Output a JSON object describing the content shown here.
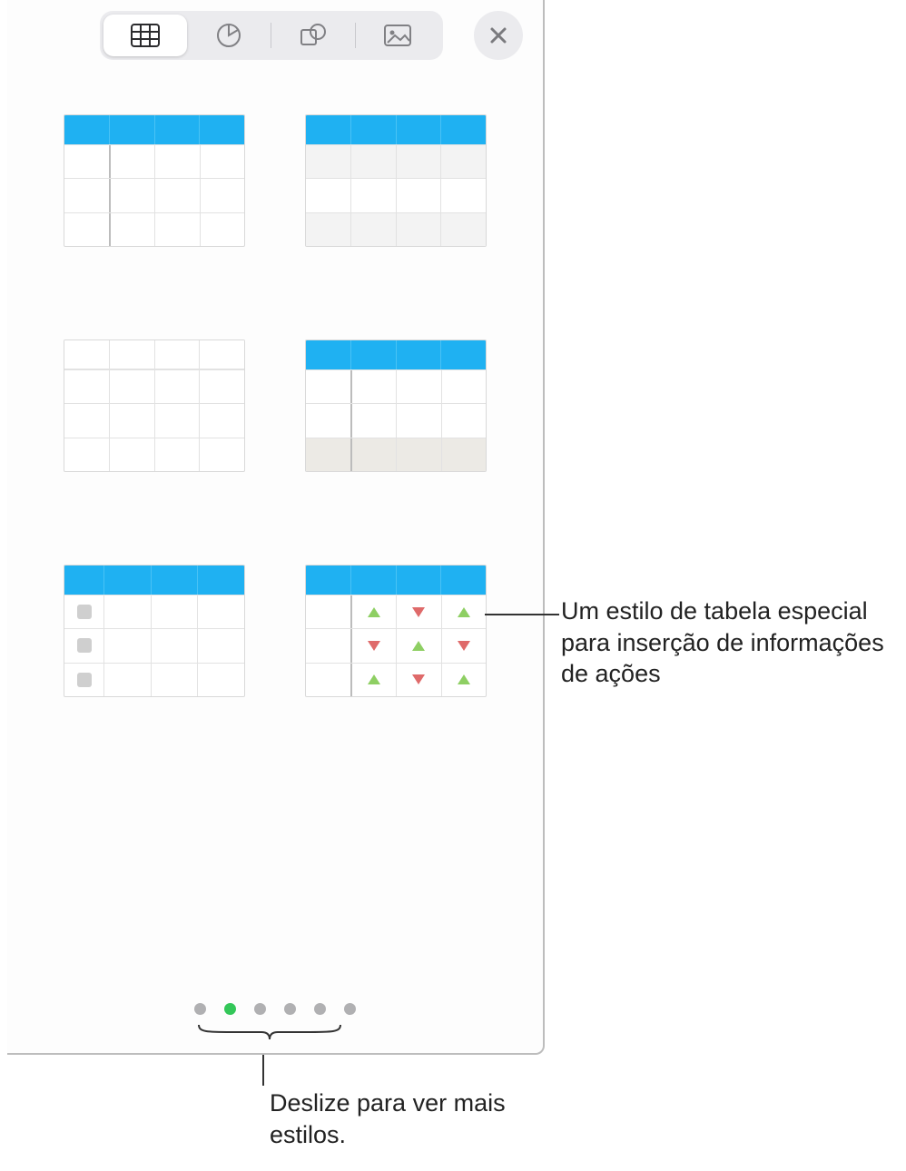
{
  "toolbar": {
    "tabs": [
      "table",
      "chart",
      "shape",
      "image"
    ],
    "active_index": 0,
    "close_icon": "close"
  },
  "styles": [
    {
      "id": "blue-header-firstcol",
      "header": "blue",
      "firstcol": true,
      "rows": "plain"
    },
    {
      "id": "blue-header-alt",
      "header": "blue",
      "firstcol": false,
      "rows": "alt"
    },
    {
      "id": "plain-grid",
      "header": "none",
      "firstcol": false,
      "rows": "plain"
    },
    {
      "id": "blue-header-footer",
      "header": "blue",
      "firstcol": true,
      "rows": "footer"
    },
    {
      "id": "blue-header-checkbox",
      "header": "blue",
      "firstcol": false,
      "rows": "checkbox"
    },
    {
      "id": "blue-header-stocks",
      "header": "blue",
      "firstcol": true,
      "rows": "stocks"
    }
  ],
  "pager": {
    "count": 6,
    "active_index": 1
  },
  "callouts": {
    "stocks": "Um estilo de tabela especial para inserção de informações de ações",
    "pager": "Deslize para ver mais estilos."
  },
  "colors": {
    "accent_blue": "#1fb1f2",
    "dot_active": "#34c759",
    "up": "#8ecf63",
    "down": "#df6a6a"
  }
}
